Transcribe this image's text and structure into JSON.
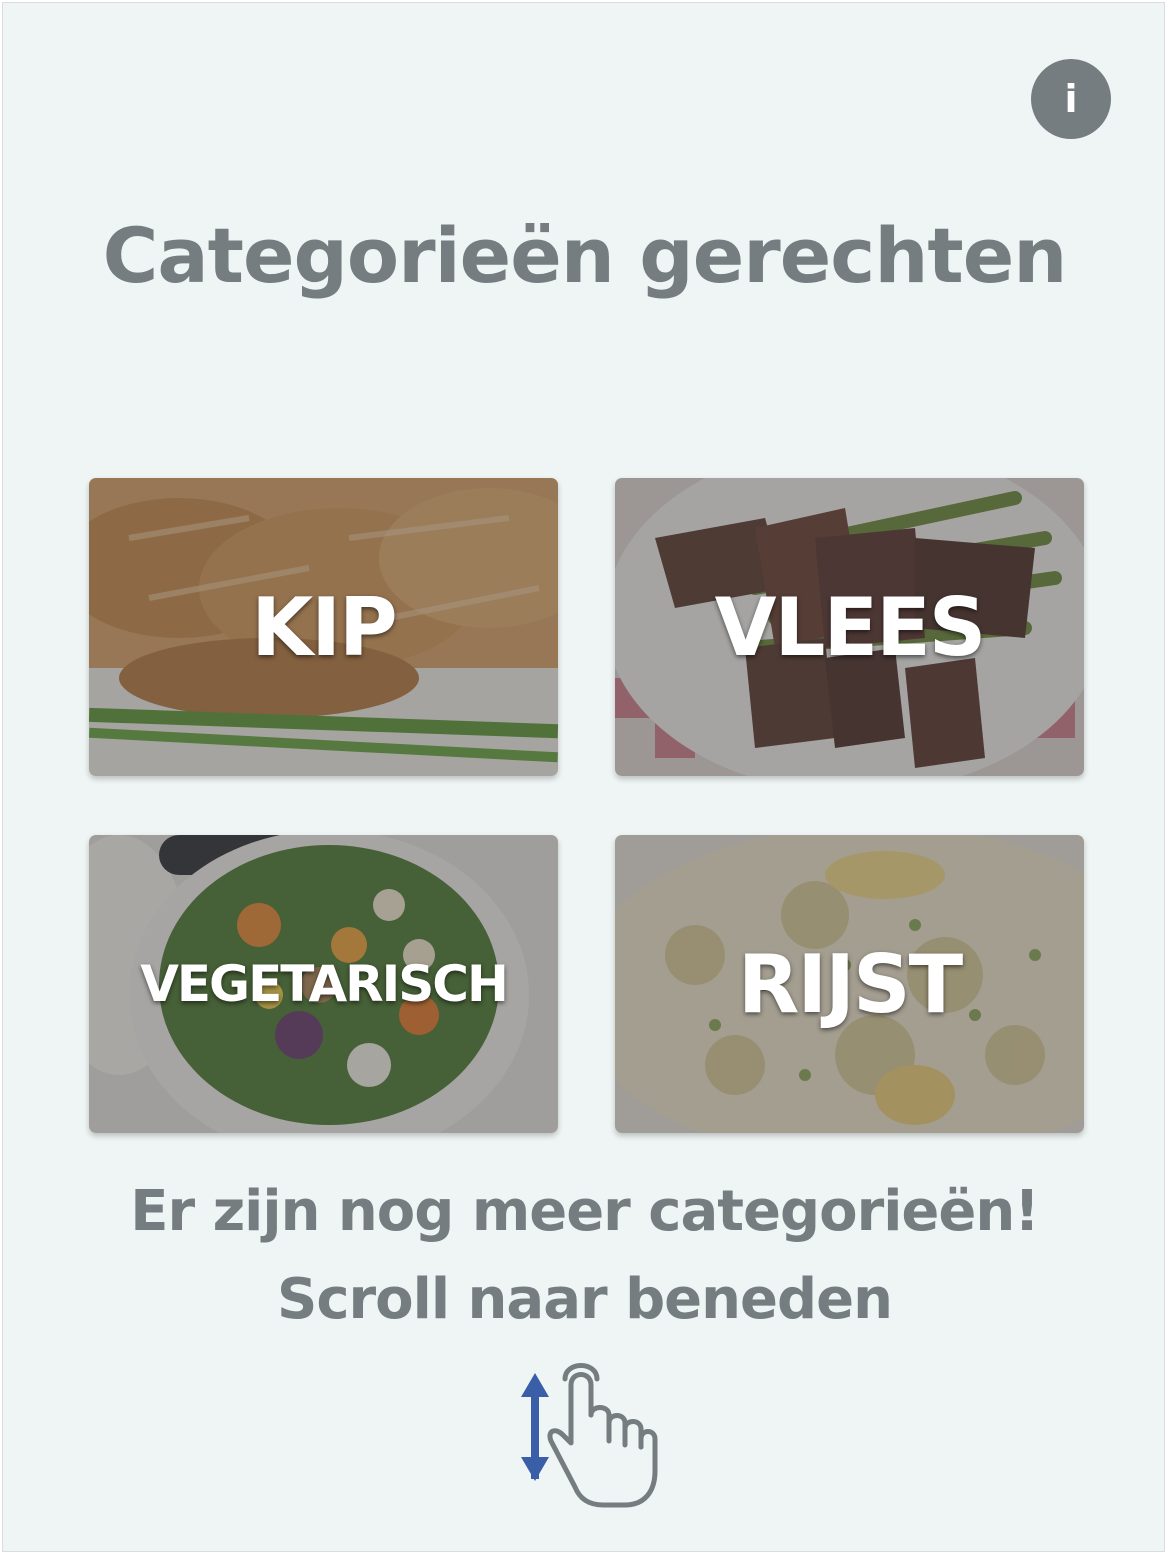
{
  "header": {
    "info_label": "i",
    "title": "Categorieën gerechten"
  },
  "categories": [
    {
      "label": "KIP"
    },
    {
      "label": "VLEES"
    },
    {
      "label": "VEGETARISCH"
    },
    {
      "label": "RIJST"
    }
  ],
  "footer": {
    "hint_line1": "Er zijn nog meer categorieën!",
    "hint_line2": "Scroll naar beneden"
  },
  "icons": {
    "info": "info-icon",
    "scroll": "scroll-gesture-icon"
  },
  "colors": {
    "background": "#eef5f4",
    "text": "#757d80",
    "arrow": "#3b5ea8"
  }
}
